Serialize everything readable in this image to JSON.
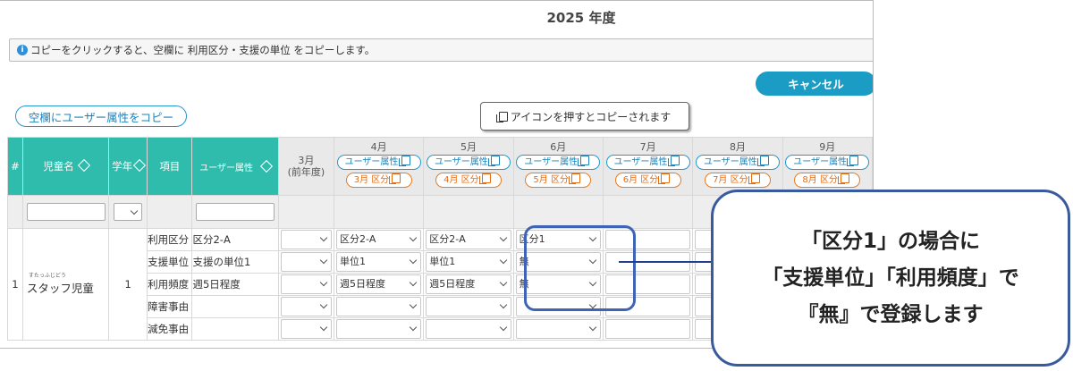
{
  "header": {
    "year": "2025 年度"
  },
  "info": {
    "icon": "i",
    "text": "コピーをクリックすると、空欄に 利用区分・支援の単位 をコピーします。"
  },
  "buttons": {
    "cancel": "キャンセル",
    "copy_user_attr": "空欄にユーザー属性をコピー"
  },
  "tooltip": {
    "text": "アイコンを押すとコピーされます"
  },
  "columns": {
    "num": "#",
    "child_name": "児童名",
    "grade": "学年",
    "item": "項目",
    "user_attr": "ユーザー属性",
    "prev_month": "3月",
    "prev_month_note": "(前年度)",
    "user_attr_pill": "ユーザー属性",
    "months": [
      {
        "label": "4月",
        "kubun": "3月 区分"
      },
      {
        "label": "5月",
        "kubun": "4月 区分"
      },
      {
        "label": "6月",
        "kubun": "5月 区分"
      },
      {
        "label": "7月",
        "kubun": "6月 区分"
      },
      {
        "label": "8月",
        "kubun": "7月 区分"
      },
      {
        "label": "9月",
        "kubun": "8月 区分"
      }
    ]
  },
  "row": {
    "num": "1",
    "name_ruby": "すたっふじどう",
    "name": "スタッフ児童",
    "grade": "1",
    "items": [
      {
        "item": "利用区分",
        "attr": "区分2-A",
        "apr": "区分2-A",
        "may": "区分2-A",
        "jun": "区分1"
      },
      {
        "item": "支援単位",
        "attr": "支援の単位1",
        "apr": "単位1",
        "may": "単位1",
        "jun": "無"
      },
      {
        "item": "利用頻度",
        "attr": "週5日程度",
        "apr": "週5日程度",
        "may": "週5日程度",
        "jun": "無"
      },
      {
        "item": "障害事由",
        "attr": "",
        "apr": "",
        "may": "",
        "jun": ""
      },
      {
        "item": "減免事由",
        "attr": "",
        "apr": "",
        "may": "",
        "jun": ""
      }
    ]
  },
  "callout": {
    "line1": "「区分1」の場合に",
    "line2": "「支援単位」「利用頻度」で",
    "line3": "『無』で登録します"
  },
  "colors": {
    "header_teal": "#2fbcac",
    "accent_blue": "#1a9cc5",
    "kubun_orange": "#e46c13",
    "callout_border": "#3a5a9e"
  }
}
